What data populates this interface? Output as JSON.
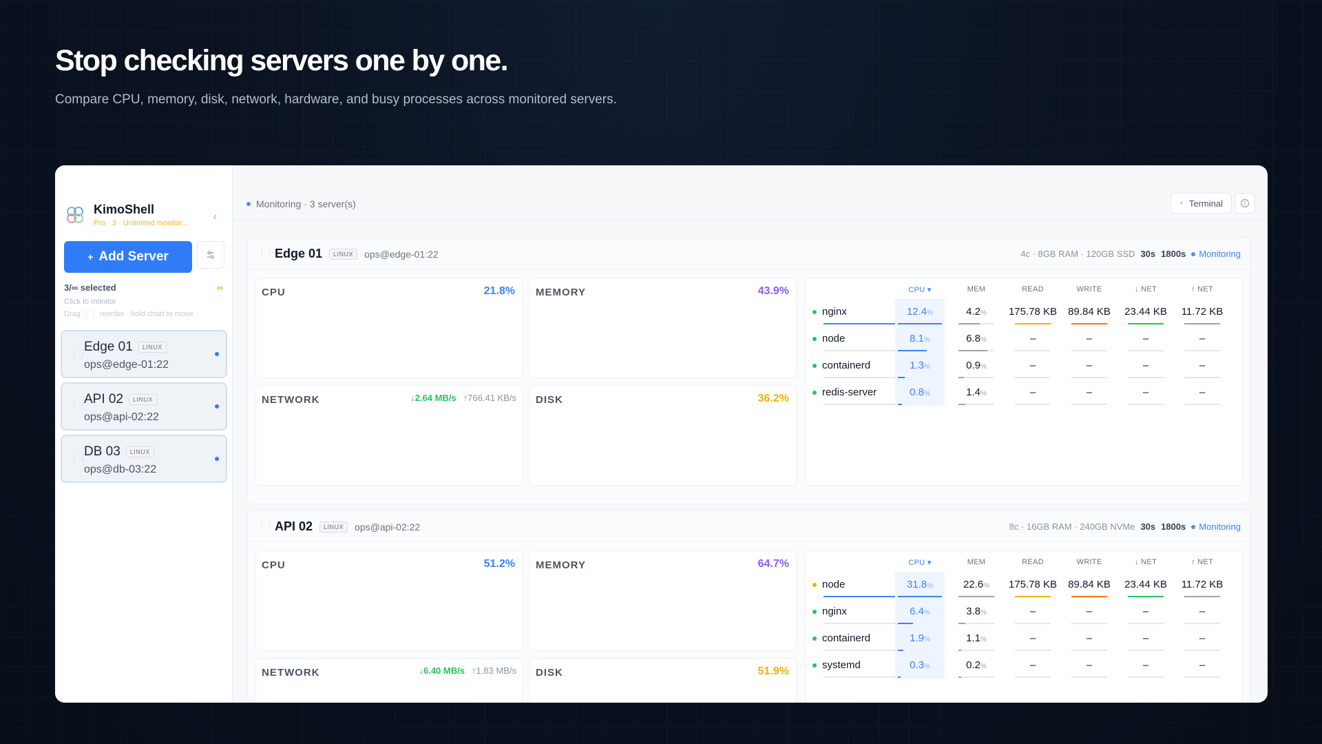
{
  "hero": {
    "title": "Stop checking servers one by one.",
    "subtitle": "Compare CPU, memory, disk, network, hardware, and busy processes across monitored servers."
  },
  "sidebar": {
    "brand_name": "KimoShell",
    "brand_sub": "Pro · 3 · Unlimited monitor...",
    "add_button": "Add Server",
    "selected": "3/∞ selected",
    "infinity": "∞",
    "hint_click": "Click to monitor",
    "hint_drag": "Drag ⋮⋮ reorder · hold chart to move",
    "servers": [
      {
        "name": "Edge 01",
        "os": "LINUX",
        "ssh": "ops@edge-01:22"
      },
      {
        "name": "API 02",
        "os": "LINUX",
        "ssh": "ops@api-02:22"
      },
      {
        "name": "DB 03",
        "os": "LINUX",
        "ssh": "ops@db-03:22"
      }
    ]
  },
  "topbar": {
    "status": "Monitoring · 3 server(s)",
    "terminal_button": "Terminal"
  },
  "process_headers": {
    "cpu": "CPU ▾",
    "mem": "MEM",
    "read": "READ",
    "write": "WRITE",
    "net_down": "↓ NET",
    "net_up": "↑ NET"
  },
  "colors": {
    "accent": "#2f7cf6",
    "cpu": "#3b82f6",
    "memory": "#8b5cf6",
    "disk": "#eab308",
    "network": "#22c55e"
  },
  "cards": [
    {
      "name": "Edge 01",
      "os": "LINUX",
      "ssh": "ops@edge-01:22",
      "spec": "4c · 8GB RAM · 120GB SSD",
      "interval": "30s",
      "window": "1800s",
      "status": "Monitoring",
      "cpu_label": "CPU",
      "cpu_value": "21.8%",
      "memory_label": "MEMORY",
      "memory_value": "43.9%",
      "network_label": "NETWORK",
      "net_down": "↓2.64 MB/s",
      "net_up": "↑766.41 KB/s",
      "disk_label": "DISK",
      "disk_value": "36.2%",
      "processes": [
        {
          "name": "nginx",
          "status": "green",
          "cpu": "12.4",
          "mem": "4.2",
          "read": "175.78 KB",
          "write": "89.84 KB",
          "net_down": "23.44 KB",
          "net_up": "11.72 KB",
          "cpu_frac": 1.0,
          "mem_frac": 0.6
        },
        {
          "name": "node",
          "status": "green",
          "cpu": "8.1",
          "mem": "6.8",
          "read": "–",
          "write": "–",
          "net_down": "–",
          "net_up": "–",
          "cpu_frac": 0.65,
          "mem_frac": 0.8
        },
        {
          "name": "containerd",
          "status": "green",
          "cpu": "1.3",
          "mem": "0.9",
          "read": "–",
          "write": "–",
          "net_down": "–",
          "net_up": "–",
          "cpu_frac": 0.15,
          "mem_frac": 0.15
        },
        {
          "name": "redis-server",
          "status": "green",
          "cpu": "0.8",
          "mem": "1.4",
          "read": "–",
          "write": "–",
          "net_down": "–",
          "net_up": "–",
          "cpu_frac": 0.1,
          "mem_frac": 0.2
        }
      ]
    },
    {
      "name": "API 02",
      "os": "LINUX",
      "ssh": "ops@api-02:22",
      "spec": "8c · 16GB RAM · 240GB NVMe",
      "interval": "30s",
      "window": "1800s",
      "status": "Monitoring",
      "cpu_label": "CPU",
      "cpu_value": "51.2%",
      "memory_label": "MEMORY",
      "memory_value": "64.7%",
      "network_label": "NETWORK",
      "net_down": "↓6.40 MB/s",
      "net_up": "↑1.83 MB/s",
      "disk_label": "DISK",
      "disk_value": "51.9%",
      "processes": [
        {
          "name": "node",
          "status": "yellow",
          "cpu": "31.8",
          "mem": "22.6",
          "read": "175.78 KB",
          "write": "89.84 KB",
          "net_down": "23.44 KB",
          "net_up": "11.72 KB",
          "cpu_frac": 1.0,
          "mem_frac": 1.0
        },
        {
          "name": "nginx",
          "status": "green",
          "cpu": "6.4",
          "mem": "3.8",
          "read": "–",
          "write": "–",
          "net_down": "–",
          "net_up": "–",
          "cpu_frac": 0.35,
          "mem_frac": 0.2
        },
        {
          "name": "containerd",
          "status": "green",
          "cpu": "1.9",
          "mem": "1.1",
          "read": "–",
          "write": "–",
          "net_down": "–",
          "net_up": "–",
          "cpu_frac": 0.12,
          "mem_frac": 0.08
        },
        {
          "name": "systemd",
          "status": "green",
          "cpu": "0.3",
          "mem": "0.2",
          "read": "–",
          "write": "–",
          "net_down": "–",
          "net_up": "–",
          "cpu_frac": 0.04,
          "mem_frac": 0.04
        }
      ]
    }
  ]
}
